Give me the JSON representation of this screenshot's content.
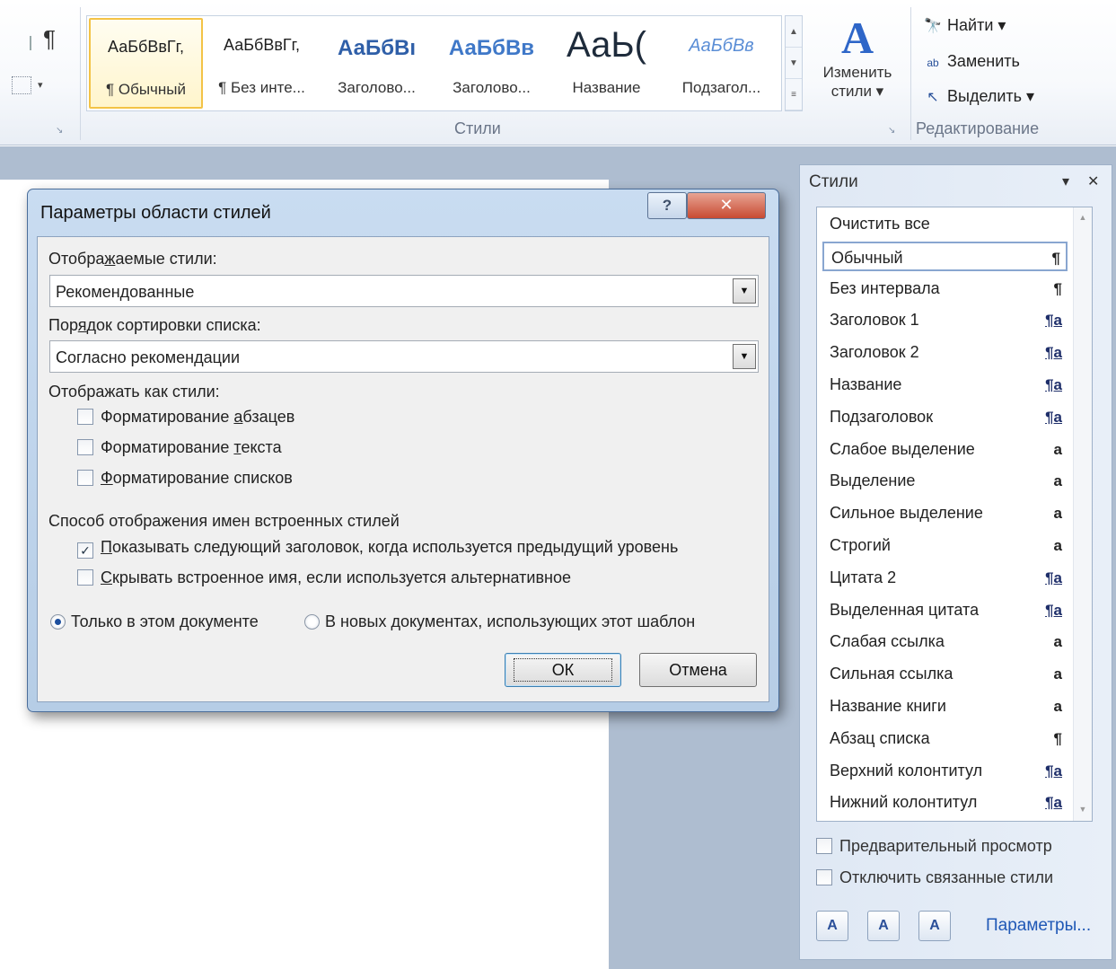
{
  "ribbon": {
    "para_mark": "¶",
    "launcher_mark": "↘",
    "gallery": [
      {
        "sample": "АаБбВвГг,",
        "name": "¶ Обычный",
        "sample_color": "#1e1e1e",
        "selected": true
      },
      {
        "sample": "АаБбВвГг,",
        "name": "¶ Без инте...",
        "sample_color": "#1e1e1e"
      },
      {
        "sample": "АаБбВı",
        "name": "Заголово...",
        "sample_color": "#2f5fa8"
      },
      {
        "sample": "АаБбВв",
        "name": "Заголово...",
        "sample_color": "#3f78c8"
      },
      {
        "sample": "АаЬ(",
        "name": "Название",
        "sample_color": "#1e2b3b"
      },
      {
        "sample": "АаБбВв",
        "name": "Подзагол...",
        "sample_color": "#5b8ed6"
      }
    ],
    "gallery_scroll": [
      "▲",
      "▼",
      "≡"
    ],
    "styles_group_label": "Стили",
    "change_styles": {
      "icon": "A",
      "line1": "Изменить",
      "line2": "стили ▾"
    },
    "editing": {
      "find": "Найти ▾",
      "find_icon": "🔭",
      "replace": "Заменить",
      "replace_icon": "ab",
      "select": "Выделить ▾",
      "select_icon": "↖",
      "group_label": "Редактирование"
    }
  },
  "pane": {
    "title": "Стили",
    "menu_icon": "▾",
    "close_icon": "✕",
    "items": [
      {
        "label": "Очистить все",
        "kind": ""
      },
      {
        "label": "Обычный",
        "kind": "¶",
        "selected": true
      },
      {
        "label": "Без интервала",
        "kind": "¶"
      },
      {
        "label": "Заголовок 1",
        "kind": "¶a",
        "linked": true
      },
      {
        "label": "Заголовок 2",
        "kind": "¶a",
        "linked": true
      },
      {
        "label": "Название",
        "kind": "¶a",
        "linked": true
      },
      {
        "label": "Подзаголовок",
        "kind": "¶a",
        "linked": true
      },
      {
        "label": "Слабое выделение",
        "kind": "a"
      },
      {
        "label": "Выделение",
        "kind": "a"
      },
      {
        "label": "Сильное выделение",
        "kind": "a"
      },
      {
        "label": "Строгий",
        "kind": "a"
      },
      {
        "label": "Цитата 2",
        "kind": "¶a",
        "linked": true
      },
      {
        "label": "Выделенная цитата",
        "kind": "¶a",
        "linked": true
      },
      {
        "label": "Слабая ссылка",
        "kind": "a"
      },
      {
        "label": "Сильная ссылка",
        "kind": "a"
      },
      {
        "label": "Название книги",
        "kind": "a"
      },
      {
        "label": "Абзац списка",
        "kind": "¶"
      },
      {
        "label": "Верхний колонтитул",
        "kind": "¶a",
        "linked": true
      },
      {
        "label": "Нижний колонтитул",
        "kind": "¶a",
        "linked": true
      }
    ],
    "scroll_up": "▲",
    "scroll_down": "▼",
    "preview_label": "Предварительный просмотр",
    "preview_checked": false,
    "linked_label": "Отключить связанные стили",
    "linked_checked": false,
    "btn_new": "A",
    "btn_inspect": "A",
    "btn_manage": "A",
    "params_link": "Параметры..."
  },
  "dialog": {
    "title": "Параметры области стилей",
    "help": "?",
    "close": "✕",
    "shown_styles_label": "Отображаемые стили:",
    "shown_styles_value": "Рекомендованные",
    "sort_label": "Порядок сортировки списка:",
    "sort_value": "Согласно рекомендации",
    "select_arrow": "▼",
    "show_as_label": "Отображать как стили:",
    "show_as": [
      {
        "pre": "Форматирование ",
        "key": "а",
        "post": "бзацев",
        "checked": false
      },
      {
        "pre": "Форматирование ",
        "key": "т",
        "post": "екста",
        "checked": false
      },
      {
        "pre": "",
        "key": "Ф",
        "post": "орматирование списков",
        "checked": false
      }
    ],
    "builtin_label": "Способ отображения имен встроенных стилей",
    "builtin": [
      {
        "pre": "",
        "key": "П",
        "post": "оказывать следующий заголовок, когда используется предыдущий уровень",
        "checked": true
      },
      {
        "pre": "",
        "key": "С",
        "post": "крывать встроенное имя, если используется альтернативное",
        "checked": false
      }
    ],
    "check_mark": "✓",
    "radio_doc": "Только в этом документе",
    "radio_template": "В новых документах, использующих этот шаблон",
    "radio_selected": "doc",
    "ok": "ОК",
    "cancel": "Отмена"
  }
}
